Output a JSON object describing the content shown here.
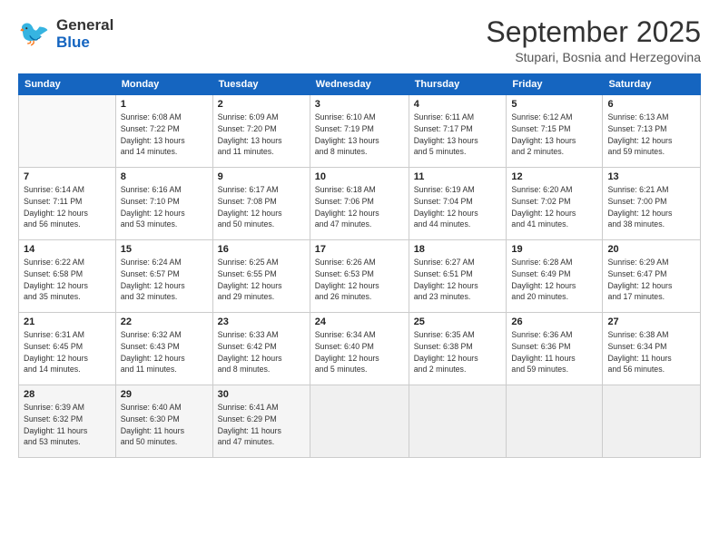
{
  "header": {
    "logo_general": "General",
    "logo_blue": "Blue",
    "title": "September 2025",
    "location": "Stupari, Bosnia and Herzegovina"
  },
  "days_of_week": [
    "Sunday",
    "Monday",
    "Tuesday",
    "Wednesday",
    "Thursday",
    "Friday",
    "Saturday"
  ],
  "weeks": [
    [
      {
        "day": "",
        "info": ""
      },
      {
        "day": "1",
        "info": "Sunrise: 6:08 AM\nSunset: 7:22 PM\nDaylight: 13 hours\nand 14 minutes."
      },
      {
        "day": "2",
        "info": "Sunrise: 6:09 AM\nSunset: 7:20 PM\nDaylight: 13 hours\nand 11 minutes."
      },
      {
        "day": "3",
        "info": "Sunrise: 6:10 AM\nSunset: 7:19 PM\nDaylight: 13 hours\nand 8 minutes."
      },
      {
        "day": "4",
        "info": "Sunrise: 6:11 AM\nSunset: 7:17 PM\nDaylight: 13 hours\nand 5 minutes."
      },
      {
        "day": "5",
        "info": "Sunrise: 6:12 AM\nSunset: 7:15 PM\nDaylight: 13 hours\nand 2 minutes."
      },
      {
        "day": "6",
        "info": "Sunrise: 6:13 AM\nSunset: 7:13 PM\nDaylight: 12 hours\nand 59 minutes."
      }
    ],
    [
      {
        "day": "7",
        "info": "Sunrise: 6:14 AM\nSunset: 7:11 PM\nDaylight: 12 hours\nand 56 minutes."
      },
      {
        "day": "8",
        "info": "Sunrise: 6:16 AM\nSunset: 7:10 PM\nDaylight: 12 hours\nand 53 minutes."
      },
      {
        "day": "9",
        "info": "Sunrise: 6:17 AM\nSunset: 7:08 PM\nDaylight: 12 hours\nand 50 minutes."
      },
      {
        "day": "10",
        "info": "Sunrise: 6:18 AM\nSunset: 7:06 PM\nDaylight: 12 hours\nand 47 minutes."
      },
      {
        "day": "11",
        "info": "Sunrise: 6:19 AM\nSunset: 7:04 PM\nDaylight: 12 hours\nand 44 minutes."
      },
      {
        "day": "12",
        "info": "Sunrise: 6:20 AM\nSunset: 7:02 PM\nDaylight: 12 hours\nand 41 minutes."
      },
      {
        "day": "13",
        "info": "Sunrise: 6:21 AM\nSunset: 7:00 PM\nDaylight: 12 hours\nand 38 minutes."
      }
    ],
    [
      {
        "day": "14",
        "info": "Sunrise: 6:22 AM\nSunset: 6:58 PM\nDaylight: 12 hours\nand 35 minutes."
      },
      {
        "day": "15",
        "info": "Sunrise: 6:24 AM\nSunset: 6:57 PM\nDaylight: 12 hours\nand 32 minutes."
      },
      {
        "day": "16",
        "info": "Sunrise: 6:25 AM\nSunset: 6:55 PM\nDaylight: 12 hours\nand 29 minutes."
      },
      {
        "day": "17",
        "info": "Sunrise: 6:26 AM\nSunset: 6:53 PM\nDaylight: 12 hours\nand 26 minutes."
      },
      {
        "day": "18",
        "info": "Sunrise: 6:27 AM\nSunset: 6:51 PM\nDaylight: 12 hours\nand 23 minutes."
      },
      {
        "day": "19",
        "info": "Sunrise: 6:28 AM\nSunset: 6:49 PM\nDaylight: 12 hours\nand 20 minutes."
      },
      {
        "day": "20",
        "info": "Sunrise: 6:29 AM\nSunset: 6:47 PM\nDaylight: 12 hours\nand 17 minutes."
      }
    ],
    [
      {
        "day": "21",
        "info": "Sunrise: 6:31 AM\nSunset: 6:45 PM\nDaylight: 12 hours\nand 14 minutes."
      },
      {
        "day": "22",
        "info": "Sunrise: 6:32 AM\nSunset: 6:43 PM\nDaylight: 12 hours\nand 11 minutes."
      },
      {
        "day": "23",
        "info": "Sunrise: 6:33 AM\nSunset: 6:42 PM\nDaylight: 12 hours\nand 8 minutes."
      },
      {
        "day": "24",
        "info": "Sunrise: 6:34 AM\nSunset: 6:40 PM\nDaylight: 12 hours\nand 5 minutes."
      },
      {
        "day": "25",
        "info": "Sunrise: 6:35 AM\nSunset: 6:38 PM\nDaylight: 12 hours\nand 2 minutes."
      },
      {
        "day": "26",
        "info": "Sunrise: 6:36 AM\nSunset: 6:36 PM\nDaylight: 11 hours\nand 59 minutes."
      },
      {
        "day": "27",
        "info": "Sunrise: 6:38 AM\nSunset: 6:34 PM\nDaylight: 11 hours\nand 56 minutes."
      }
    ],
    [
      {
        "day": "28",
        "info": "Sunrise: 6:39 AM\nSunset: 6:32 PM\nDaylight: 11 hours\nand 53 minutes."
      },
      {
        "day": "29",
        "info": "Sunrise: 6:40 AM\nSunset: 6:30 PM\nDaylight: 11 hours\nand 50 minutes."
      },
      {
        "day": "30",
        "info": "Sunrise: 6:41 AM\nSunset: 6:29 PM\nDaylight: 11 hours\nand 47 minutes."
      },
      {
        "day": "",
        "info": ""
      },
      {
        "day": "",
        "info": ""
      },
      {
        "day": "",
        "info": ""
      },
      {
        "day": "",
        "info": ""
      }
    ]
  ]
}
